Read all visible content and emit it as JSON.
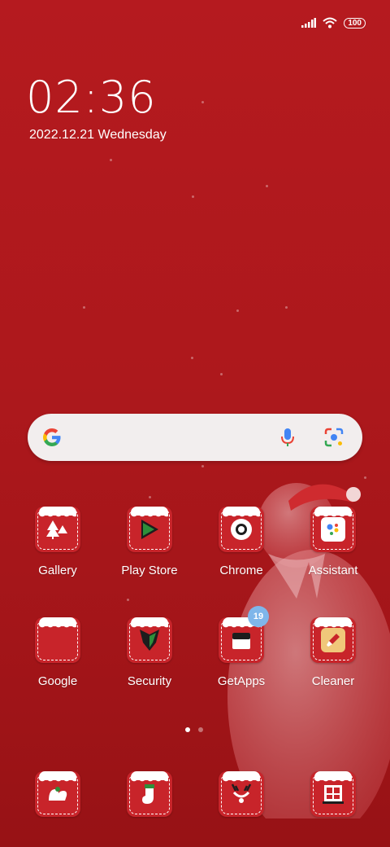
{
  "status": {
    "battery": "100"
  },
  "clock": {
    "time": "02:36",
    "date": "2022.12.21 Wednesday"
  },
  "search": {
    "placeholder": ""
  },
  "apps_row1": [
    {
      "label": "Gallery",
      "icon": "gallery-tree-icon"
    },
    {
      "label": "Play Store",
      "icon": "play-store-icon"
    },
    {
      "label": "Chrome",
      "icon": "chrome-icon"
    },
    {
      "label": "Assistant",
      "icon": "assistant-icon"
    }
  ],
  "apps_row2": [
    {
      "label": "Google",
      "icon": "google-folder-icon"
    },
    {
      "label": "Security",
      "icon": "security-icon"
    },
    {
      "label": "GetApps",
      "icon": "getapps-icon",
      "badge": "19"
    },
    {
      "label": "Cleaner",
      "icon": "cleaner-icon"
    }
  ],
  "dock": [
    {
      "icon": "phone-bells-icon"
    },
    {
      "icon": "messages-stocking-icon"
    },
    {
      "icon": "camera-reindeer-icon"
    },
    {
      "icon": "browser-window-icon"
    }
  ],
  "page_indicator": {
    "pages": 2,
    "active": 1
  },
  "colors": {
    "background": "#ad181c",
    "tile": "#c8242a",
    "badge": "#7fb6ea"
  }
}
